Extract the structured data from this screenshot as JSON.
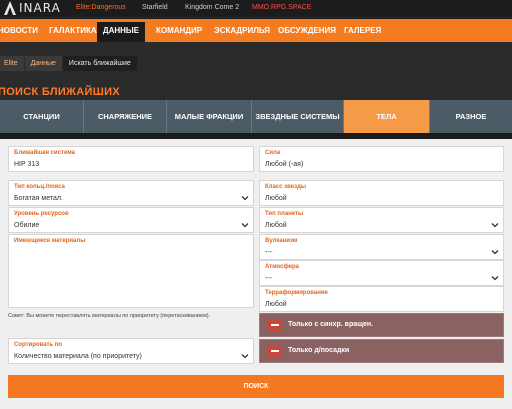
{
  "brand": {
    "name": "INARA",
    "accent": "#f47b20"
  },
  "top_links": [
    {
      "label": "Elite:Dangerous"
    },
    {
      "label": "Starfield"
    },
    {
      "label": "Kingdom Come 2"
    },
    {
      "label": "MMO.RPG.SPACE"
    }
  ],
  "nav": [
    {
      "label": "НОВОСТИ"
    },
    {
      "label": "ГАЛАКТИКА"
    },
    {
      "label": "ДАННЫЕ"
    },
    {
      "label": "КОМАНДИР"
    },
    {
      "label": "ЭСКАДРИЛЬЯ"
    },
    {
      "label": "ОБСУЖДЕНИЯ"
    },
    {
      "label": "ГАЛЕРЕЯ"
    }
  ],
  "breadcrumb": [
    "Elite",
    "Данные",
    "Искать ближайшие"
  ],
  "page_title": "ПОИСК БЛИЖАЙШИХ",
  "tabs": [
    {
      "label": "СТАНЦИИ"
    },
    {
      "label": "СНАРЯЖЕНИЕ"
    },
    {
      "label": "МАЛЫЕ ФРАКЦИИ"
    },
    {
      "label": "ЗВЕЗДНЫЕ СИСТЕМЫ"
    },
    {
      "label": "ТЕЛА"
    },
    {
      "label": "РАЗНОЕ"
    }
  ],
  "form": {
    "nearest_system": {
      "label": "Ближайшая система",
      "value": "HIP 313"
    },
    "force": {
      "label": "Сила",
      "value": "Любой (-ая)"
    },
    "ring_type": {
      "label": "Тип кольц./пояса",
      "value": "Богатая метал."
    },
    "star_class": {
      "label": "Класс звезды",
      "value": "Любой"
    },
    "resource_level": {
      "label": "Уровень ресурсов",
      "value": "Обилие"
    },
    "planet_type": {
      "label": "Тип планеты",
      "value": "Любой"
    },
    "materials": {
      "label": "Имеющиеся материалы"
    },
    "volcanism": {
      "label": "Вулканизм",
      "value": "---"
    },
    "atmosphere": {
      "label": "Атмосфера",
      "value": "---"
    },
    "terraforming": {
      "label": "Терраформирование",
      "value": "Любой"
    },
    "hint": "Совет: Вы можете переставлять материалы по приоритету (перетаскиванием).",
    "sort": {
      "label": "Сортировать по",
      "value": "Количество материала (по приоритету)"
    },
    "toggle_sync": "Только с синхр. вращен.",
    "toggle_landing": "Только д/посадки",
    "search_button": "ПОИСК"
  }
}
